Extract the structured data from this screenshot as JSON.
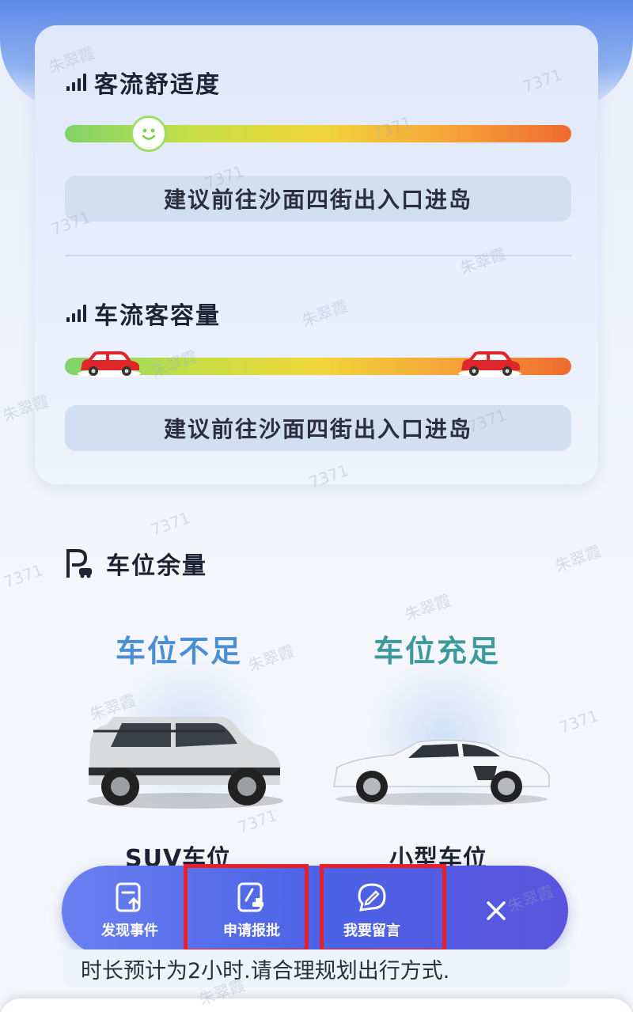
{
  "comfort": {
    "title": "客流舒适度",
    "level_fraction": 0.15,
    "advice": "建议前往沙面四街出入口进岛"
  },
  "traffic": {
    "title": "车流客容量",
    "advice": "建议前往沙面四街出入口进岛"
  },
  "parking": {
    "title": "车位余量",
    "lots": [
      {
        "status": "车位不足",
        "caption": "SUV车位",
        "status_color": "#4a8fd4"
      },
      {
        "status": "车位充足",
        "caption": "小型车位",
        "status_color": "#3c9a9a"
      }
    ]
  },
  "toolbar": {
    "report_label": "发现事件",
    "apply_label": "申请报批",
    "message_label": "我要留言",
    "close_icon": "close-icon"
  },
  "note": "时长预计为2小时.请合理规划出行方式.",
  "watermarks": [
    "朱翠霞",
    "7371"
  ],
  "colors": {
    "toolbar": "#4b63e6",
    "highlight": "#e8202a"
  }
}
